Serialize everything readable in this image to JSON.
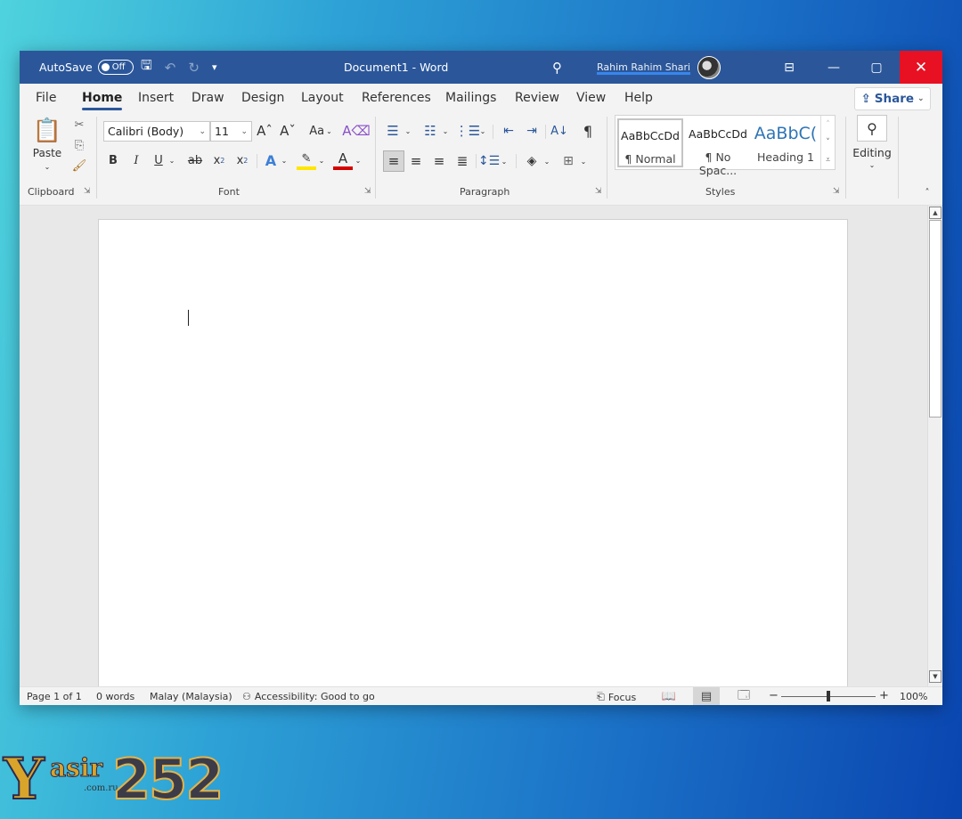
{
  "colors": {
    "titlebar": "#2b579a",
    "close": "#e81123",
    "accent": "#2b579a"
  },
  "titlebar": {
    "autosave_label": "AutoSave",
    "autosave_state": "Off",
    "doc_title": "Document1  -  Word",
    "user_name": "Rahim Rahim Shari",
    "icons": {
      "save": "save-icon",
      "undo": "undo-icon",
      "redo": "redo-icon",
      "customize": "customize-qat-icon",
      "search": "search-icon",
      "ribbon_display": "ribbon-display-icon",
      "minimize": "minimize-icon",
      "maximize": "maximize-icon",
      "close": "close-icon"
    }
  },
  "tabs": [
    "File",
    "Home",
    "Insert",
    "Draw",
    "Design",
    "Layout",
    "References",
    "Mailings",
    "Review",
    "View",
    "Help"
  ],
  "active_tab": "Home",
  "share_label": "Share",
  "ribbon": {
    "clipboard": {
      "paste_label": "Paste",
      "group_label": "Clipboard"
    },
    "font": {
      "font_name": "Calibri (Body)",
      "font_size": "11",
      "case_label": "Aa",
      "group_label": "Font",
      "bold": "B",
      "italic": "I",
      "underline": "U",
      "strike": "ab",
      "subscript": "x",
      "superscript": "x",
      "effects": "A",
      "color": "A"
    },
    "paragraph": {
      "group_label": "Paragraph",
      "show_marks": "¶"
    },
    "styles": {
      "group_label": "Styles",
      "items": [
        {
          "sample": "AaBbCcDd",
          "name": "¶ Normal"
        },
        {
          "sample": "AaBbCcDd",
          "name": "¶ No Spac..."
        },
        {
          "sample": "AaBbC(",
          "name": "Heading 1"
        }
      ]
    },
    "editing": {
      "label": "Editing"
    }
  },
  "statusbar": {
    "page": "Page 1 of 1",
    "words": "0 words",
    "language": "Malay (Malaysia)",
    "accessibility": "Accessibility: Good to go",
    "focus": "Focus",
    "zoom": "100%",
    "zoom_minus": "−",
    "zoom_plus": "+"
  },
  "watermark": {
    "y": "Y",
    "asir": "asir",
    "number": "252",
    "domain": ".com.ru"
  }
}
